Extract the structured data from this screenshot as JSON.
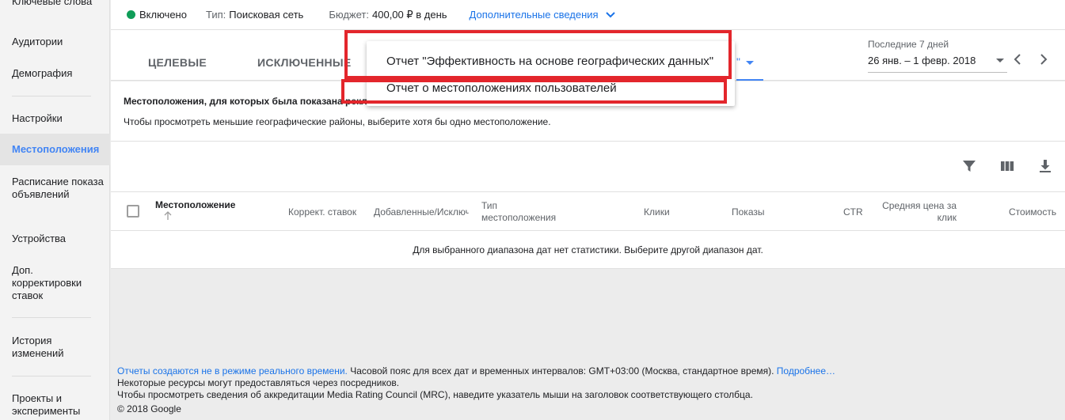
{
  "sidebar": {
    "items": [
      {
        "label": "Ключевые слова",
        "active": false
      },
      {
        "label": "Аудитории",
        "active": false
      },
      {
        "label": "Демография",
        "active": false
      },
      {
        "label": "Настройки",
        "active": false
      },
      {
        "label": "Местоположения",
        "active": true
      },
      {
        "label": "Расписание показа объявлений",
        "active": false
      },
      {
        "label": "Устройства",
        "active": false
      },
      {
        "label": "Доп. корректировки ставок",
        "active": false
      },
      {
        "label": "История изменений",
        "active": false
      },
      {
        "label": "Проекты и эксперименты",
        "active": false
      }
    ]
  },
  "topbar": {
    "status": "Включено",
    "type_label": "Тип:",
    "type_value": "Поисковая сеть",
    "budget_label": "Бюджет:",
    "budget_value": "400,00 ₽ в день",
    "more_link": "Дополнительные сведения"
  },
  "tabs": {
    "targeted": "ЦЕЛЕВЫЕ",
    "excluded": "ИСКЛЮЧЕННЫЕ",
    "selector_suffix": "\""
  },
  "date": {
    "caption": "Последние 7 дней",
    "range": "26 янв. – 1 февр. 2018"
  },
  "dropdown": {
    "items": [
      "Отчет \"Эффективность на основе географических данных\"",
      "Отчет о местоположениях пользователей"
    ]
  },
  "content": {
    "title": "Местоположения, для которых была показана реклама",
    "subtitle": "Чтобы просмотреть меньшие географические районы, выберите хотя бы одно местоположение.",
    "empty_message": "Для выбранного диапазона дат нет статистики. Выберите другой диапазон дат."
  },
  "table": {
    "columns": {
      "location": "Местоположение",
      "bid_adj": "Коррект. ставок",
      "added_excluded": "Добавленные/Исключ",
      "loc_type_1": "Тип",
      "loc_type_2": "местоположения",
      "clicks": "Клики",
      "impressions": "Показы",
      "ctr": "CTR",
      "avg_cpc_1": "Средняя цена за",
      "avg_cpc_2": "клик",
      "cost": "Стоимость"
    }
  },
  "footer": {
    "link1": "Отчеты создаются не в режиме реального времени.",
    "text1": " Часовой пояс для всех дат и временных интервалов: GMT+03:00 (Москва, стандартное время). ",
    "link2": "Подробнее…",
    "line2": "Некоторые ресурсы могут предоставляться через посредников.",
    "line3": "Чтобы просмотреть сведения об аккредитации Media Rating Council (MRC), наведите указатель мыши на заголовок соответствующего столбца.",
    "copyright": "© 2018 Google"
  },
  "colors": {
    "accent": "#4285f4",
    "link": "#1a73e8",
    "status_green": "#0f9d58",
    "highlight_red": "#e3262c"
  },
  "icons": [
    "check-circle-icon",
    "chevron-down-icon",
    "chevron-left-icon",
    "chevron-right-icon",
    "filter-icon",
    "columns-icon",
    "download-icon",
    "arrow-up-icon"
  ]
}
